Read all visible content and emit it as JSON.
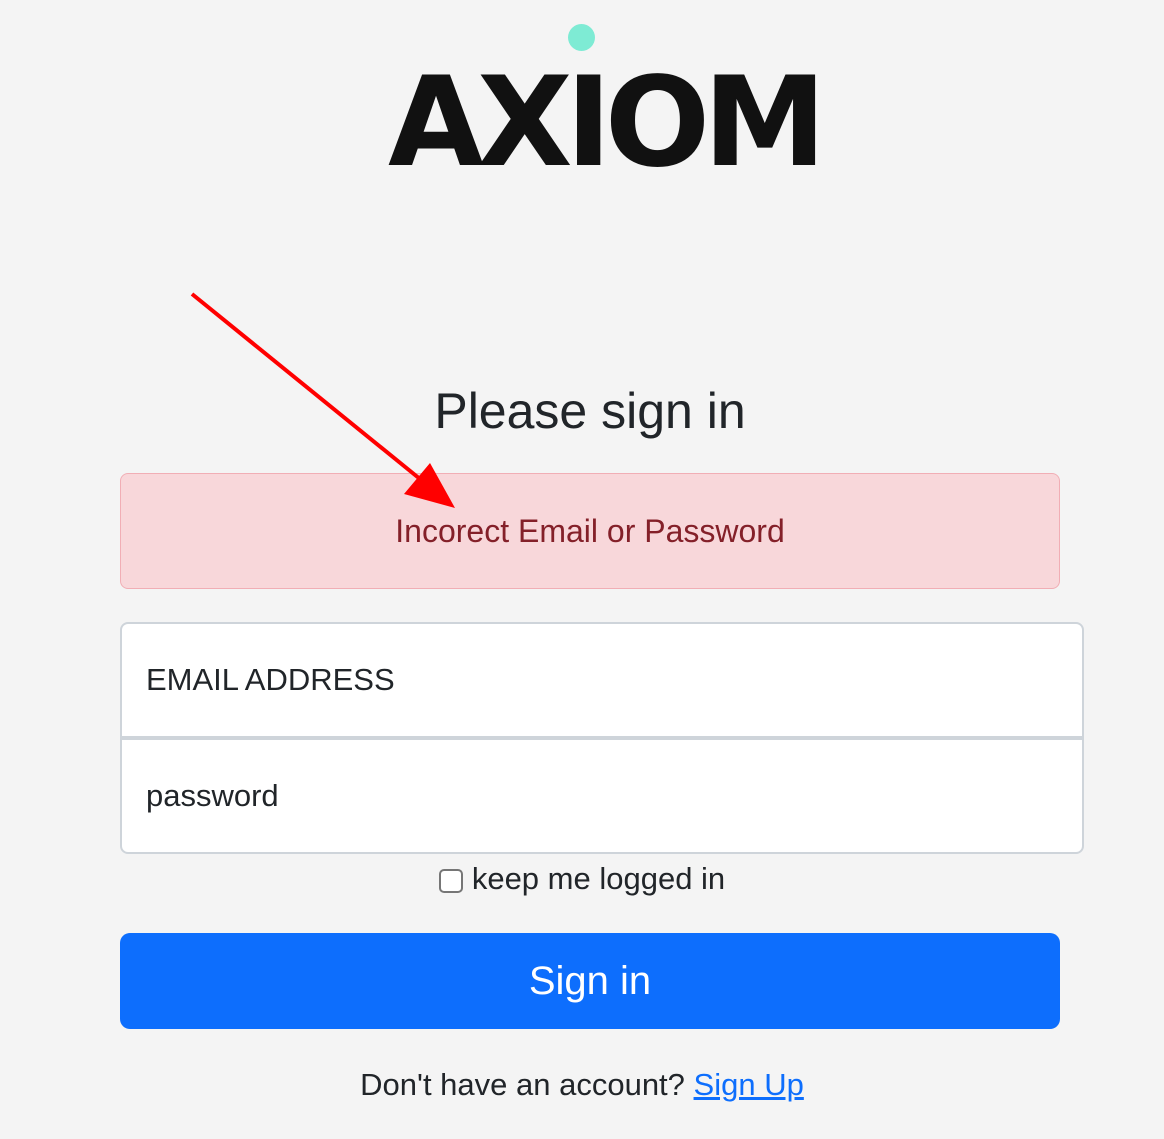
{
  "brand": {
    "logo_text": "AXIOM",
    "dot_color": "#7eebd4"
  },
  "form": {
    "heading": "Please sign in",
    "error_message": "Incorect Email or Password",
    "email_placeholder": "EMAIL ADDRESS",
    "password_placeholder": "password",
    "remember_label": "keep me logged in",
    "remember_checked": false,
    "submit_label": "Sign in",
    "submit_color": "#0d6efd"
  },
  "footer": {
    "prompt": "Don't have an account?",
    "signup_link": "Sign Up"
  },
  "annotation": {
    "arrow_color": "#ff0000"
  }
}
